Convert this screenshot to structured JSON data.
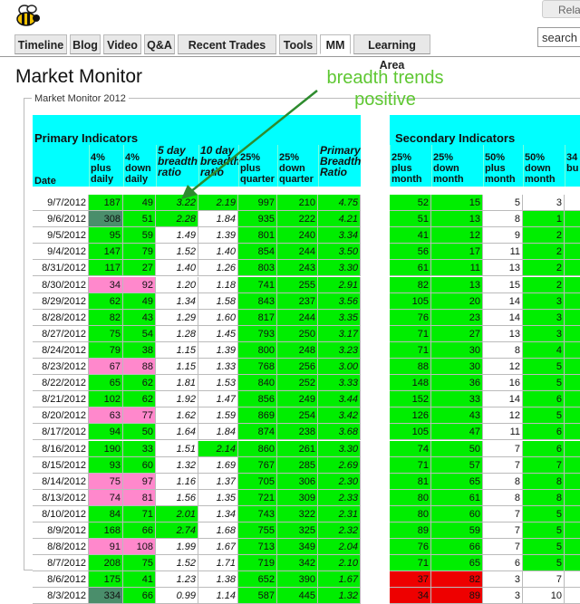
{
  "header": {
    "relay_label": "Rela",
    "search_placeholder": "search"
  },
  "tabs": [
    {
      "label": "Timeline",
      "active": false
    },
    {
      "label": "Blog",
      "active": false
    },
    {
      "label": "Video",
      "active": false
    },
    {
      "label": "Q&A",
      "active": false
    },
    {
      "label": "Recent Trades",
      "active": false
    },
    {
      "label": "Tools",
      "active": false
    },
    {
      "label": "MM",
      "active": true
    },
    {
      "label": "Learning Area",
      "active": false
    }
  ],
  "page_title": "Market Monitor",
  "annotation": {
    "line1": "breadth trends",
    "line2": "positive",
    "color": "#5ec732"
  },
  "panel_title": "Market Monitor 2012",
  "groups": {
    "primary": "Primary Indicators",
    "secondary": "Secondary Indicators"
  },
  "columns": {
    "date": "Date",
    "up4": [
      "4%",
      "plus",
      "daily"
    ],
    "down4": [
      "4%",
      "down",
      "daily"
    ],
    "ratio5": [
      "5 day",
      "breadth",
      "ratio"
    ],
    "ratio10": [
      "10 day",
      "breadth",
      "ratio"
    ],
    "up25q": [
      "25%",
      "plus",
      "quarter"
    ],
    "down25q": [
      "25%",
      "down",
      "quarter"
    ],
    "pbr": [
      "Primary",
      "Breadth",
      "Ratio"
    ],
    "up25m": [
      "25%",
      "plus",
      "month"
    ],
    "down25m": [
      "25%",
      "down",
      "month"
    ],
    "up50m": [
      "50%",
      "plus",
      "month"
    ],
    "down50m": [
      "50%",
      "down",
      "month"
    ],
    "c34": [
      "34",
      "bu"
    ]
  },
  "colors": {
    "green": "#00ee00",
    "pink": "#ff88cc",
    "gray": "#4a8e6b",
    "red": "#ee0000",
    "cyan": "#00ffff"
  },
  "rows": [
    {
      "date": "9/7/2012",
      "up4": "187",
      "down4": "49",
      "r5": "3.22",
      "r10": "2.19",
      "uq": "997",
      "dq": "210",
      "pbr": "4.75",
      "um": "52",
      "dm": "15",
      "u50": "5",
      "d50": "3",
      "f": [
        "g",
        "g",
        "g",
        "g",
        "g",
        "g",
        "g",
        "g",
        "g",
        "w",
        "w"
      ]
    },
    {
      "date": "9/6/2012",
      "up4": "308",
      "down4": "51",
      "r5": "2.28",
      "r10": "1.84",
      "uq": "935",
      "dq": "222",
      "pbr": "4.21",
      "um": "51",
      "dm": "13",
      "u50": "8",
      "d50": "1",
      "f": [
        "x",
        "g",
        "g",
        "w",
        "g",
        "g",
        "g",
        "g",
        "g",
        "w",
        "g"
      ]
    },
    {
      "date": "9/5/2012",
      "up4": "95",
      "down4": "59",
      "r5": "1.49",
      "r10": "1.39",
      "uq": "801",
      "dq": "240",
      "pbr": "3.34",
      "um": "41",
      "dm": "12",
      "u50": "9",
      "d50": "2",
      "f": [
        "g",
        "g",
        "w",
        "w",
        "g",
        "g",
        "g",
        "g",
        "g",
        "w",
        "g"
      ]
    },
    {
      "date": "9/4/2012",
      "up4": "147",
      "down4": "79",
      "r5": "1.52",
      "r10": "1.40",
      "uq": "854",
      "dq": "244",
      "pbr": "3.50",
      "um": "56",
      "dm": "17",
      "u50": "11",
      "d50": "2",
      "f": [
        "g",
        "g",
        "w",
        "w",
        "g",
        "g",
        "g",
        "g",
        "g",
        "w",
        "g"
      ]
    },
    {
      "date": "8/31/2012",
      "up4": "117",
      "down4": "27",
      "r5": "1.40",
      "r10": "1.26",
      "uq": "803",
      "dq": "243",
      "pbr": "3.30",
      "um": "61",
      "dm": "11",
      "u50": "13",
      "d50": "2",
      "f": [
        "g",
        "g",
        "w",
        "w",
        "g",
        "g",
        "g",
        "g",
        "g",
        "w",
        "g"
      ]
    },
    {
      "date": "8/30/2012",
      "up4": "34",
      "down4": "92",
      "r5": "1.20",
      "r10": "1.18",
      "uq": "741",
      "dq": "255",
      "pbr": "2.91",
      "um": "82",
      "dm": "13",
      "u50": "15",
      "d50": "2",
      "f": [
        "p",
        "p",
        "w",
        "w",
        "g",
        "g",
        "g",
        "g",
        "g",
        "w",
        "g"
      ]
    },
    {
      "date": "8/29/2012",
      "up4": "62",
      "down4": "49",
      "r5": "1.34",
      "r10": "1.58",
      "uq": "843",
      "dq": "237",
      "pbr": "3.56",
      "um": "105",
      "dm": "20",
      "u50": "14",
      "d50": "3",
      "f": [
        "g",
        "g",
        "w",
        "w",
        "g",
        "g",
        "g",
        "g",
        "g",
        "w",
        "g"
      ]
    },
    {
      "date": "8/28/2012",
      "up4": "82",
      "down4": "43",
      "r5": "1.29",
      "r10": "1.60",
      "uq": "817",
      "dq": "244",
      "pbr": "3.35",
      "um": "76",
      "dm": "23",
      "u50": "14",
      "d50": "3",
      "f": [
        "g",
        "g",
        "w",
        "w",
        "g",
        "g",
        "g",
        "g",
        "g",
        "w",
        "g"
      ]
    },
    {
      "date": "8/27/2012",
      "up4": "75",
      "down4": "54",
      "r5": "1.28",
      "r10": "1.45",
      "uq": "793",
      "dq": "250",
      "pbr": "3.17",
      "um": "71",
      "dm": "27",
      "u50": "13",
      "d50": "3",
      "f": [
        "g",
        "g",
        "w",
        "w",
        "g",
        "g",
        "g",
        "g",
        "g",
        "w",
        "g"
      ]
    },
    {
      "date": "8/24/2012",
      "up4": "79",
      "down4": "38",
      "r5": "1.15",
      "r10": "1.39",
      "uq": "800",
      "dq": "248",
      "pbr": "3.23",
      "um": "71",
      "dm": "30",
      "u50": "8",
      "d50": "4",
      "f": [
        "g",
        "g",
        "w",
        "w",
        "g",
        "g",
        "g",
        "g",
        "g",
        "w",
        "g"
      ]
    },
    {
      "date": "8/23/2012",
      "up4": "67",
      "down4": "88",
      "r5": "1.15",
      "r10": "1.33",
      "uq": "768",
      "dq": "256",
      "pbr": "3.00",
      "um": "88",
      "dm": "30",
      "u50": "12",
      "d50": "5",
      "f": [
        "p",
        "p",
        "w",
        "w",
        "g",
        "g",
        "g",
        "g",
        "g",
        "w",
        "g"
      ]
    },
    {
      "date": "8/22/2012",
      "up4": "65",
      "down4": "62",
      "r5": "1.81",
      "r10": "1.53",
      "uq": "840",
      "dq": "252",
      "pbr": "3.33",
      "um": "148",
      "dm": "36",
      "u50": "16",
      "d50": "5",
      "f": [
        "g",
        "g",
        "w",
        "w",
        "g",
        "g",
        "g",
        "g",
        "g",
        "w",
        "g"
      ]
    },
    {
      "date": "8/21/2012",
      "up4": "102",
      "down4": "62",
      "r5": "1.92",
      "r10": "1.47",
      "uq": "856",
      "dq": "249",
      "pbr": "3.44",
      "um": "152",
      "dm": "33",
      "u50": "14",
      "d50": "6",
      "f": [
        "g",
        "g",
        "w",
        "w",
        "g",
        "g",
        "g",
        "g",
        "g",
        "w",
        "g"
      ]
    },
    {
      "date": "8/20/2012",
      "up4": "63",
      "down4": "77",
      "r5": "1.62",
      "r10": "1.59",
      "uq": "869",
      "dq": "254",
      "pbr": "3.42",
      "um": "126",
      "dm": "43",
      "u50": "12",
      "d50": "5",
      "f": [
        "p",
        "p",
        "w",
        "w",
        "g",
        "g",
        "g",
        "g",
        "g",
        "w",
        "g"
      ]
    },
    {
      "date": "8/17/2012",
      "up4": "94",
      "down4": "50",
      "r5": "1.64",
      "r10": "1.84",
      "uq": "874",
      "dq": "238",
      "pbr": "3.68",
      "um": "105",
      "dm": "47",
      "u50": "11",
      "d50": "6",
      "f": [
        "g",
        "g",
        "w",
        "w",
        "g",
        "g",
        "g",
        "g",
        "g",
        "w",
        "g"
      ]
    },
    {
      "date": "8/16/2012",
      "up4": "190",
      "down4": "33",
      "r5": "1.51",
      "r10": "2.14",
      "uq": "860",
      "dq": "261",
      "pbr": "3.30",
      "um": "74",
      "dm": "50",
      "u50": "7",
      "d50": "6",
      "f": [
        "g",
        "g",
        "w",
        "g",
        "g",
        "g",
        "g",
        "g",
        "g",
        "w",
        "g"
      ]
    },
    {
      "date": "8/15/2012",
      "up4": "93",
      "down4": "60",
      "r5": "1.32",
      "r10": "1.69",
      "uq": "767",
      "dq": "285",
      "pbr": "2.69",
      "um": "71",
      "dm": "57",
      "u50": "7",
      "d50": "7",
      "f": [
        "g",
        "g",
        "w",
        "w",
        "g",
        "g",
        "g",
        "g",
        "g",
        "w",
        "g"
      ]
    },
    {
      "date": "8/14/2012",
      "up4": "75",
      "down4": "97",
      "r5": "1.16",
      "r10": "1.37",
      "uq": "705",
      "dq": "306",
      "pbr": "2.30",
      "um": "81",
      "dm": "65",
      "u50": "8",
      "d50": "8",
      "f": [
        "p",
        "p",
        "w",
        "w",
        "g",
        "g",
        "g",
        "g",
        "g",
        "w",
        "g"
      ]
    },
    {
      "date": "8/13/2012",
      "up4": "74",
      "down4": "81",
      "r5": "1.56",
      "r10": "1.35",
      "uq": "721",
      "dq": "309",
      "pbr": "2.33",
      "um": "80",
      "dm": "61",
      "u50": "8",
      "d50": "8",
      "f": [
        "p",
        "p",
        "w",
        "w",
        "g",
        "g",
        "g",
        "g",
        "g",
        "w",
        "g"
      ]
    },
    {
      "date": "8/10/2012",
      "up4": "84",
      "down4": "71",
      "r5": "2.01",
      "r10": "1.34",
      "uq": "743",
      "dq": "322",
      "pbr": "2.31",
      "um": "80",
      "dm": "60",
      "u50": "7",
      "d50": "5",
      "f": [
        "g",
        "g",
        "g",
        "w",
        "g",
        "g",
        "g",
        "g",
        "g",
        "w",
        "g"
      ]
    },
    {
      "date": "8/9/2012",
      "up4": "168",
      "down4": "66",
      "r5": "2.74",
      "r10": "1.68",
      "uq": "755",
      "dq": "325",
      "pbr": "2.32",
      "um": "89",
      "dm": "59",
      "u50": "7",
      "d50": "5",
      "f": [
        "g",
        "g",
        "g",
        "w",
        "g",
        "g",
        "g",
        "g",
        "g",
        "w",
        "g"
      ]
    },
    {
      "date": "8/8/2012",
      "up4": "91",
      "down4": "108",
      "r5": "1.99",
      "r10": "1.67",
      "uq": "713",
      "dq": "349",
      "pbr": "2.04",
      "um": "76",
      "dm": "66",
      "u50": "7",
      "d50": "5",
      "f": [
        "p",
        "p",
        "w",
        "w",
        "g",
        "g",
        "g",
        "g",
        "g",
        "w",
        "g"
      ]
    },
    {
      "date": "8/7/2012",
      "up4": "208",
      "down4": "75",
      "r5": "1.52",
      "r10": "1.71",
      "uq": "719",
      "dq": "342",
      "pbr": "2.10",
      "um": "71",
      "dm": "65",
      "u50": "6",
      "d50": "5",
      "f": [
        "g",
        "g",
        "w",
        "w",
        "g",
        "g",
        "g",
        "g",
        "g",
        "w",
        "g"
      ]
    },
    {
      "date": "8/6/2012",
      "up4": "175",
      "down4": "41",
      "r5": "1.23",
      "r10": "1.38",
      "uq": "652",
      "dq": "390",
      "pbr": "1.67",
      "um": "37",
      "dm": "82",
      "u50": "3",
      "d50": "7",
      "f": [
        "g",
        "g",
        "w",
        "w",
        "g",
        "g",
        "g",
        "r",
        "r",
        "w",
        "w"
      ]
    },
    {
      "date": "8/3/2012",
      "up4": "334",
      "down4": "66",
      "r5": "0.99",
      "r10": "1.14",
      "uq": "587",
      "dq": "445",
      "pbr": "1.32",
      "um": "34",
      "dm": "89",
      "u50": "3",
      "d50": "10",
      "f": [
        "x",
        "g",
        "w",
        "w",
        "g",
        "g",
        "g",
        "r",
        "r",
        "w",
        "w"
      ]
    }
  ]
}
